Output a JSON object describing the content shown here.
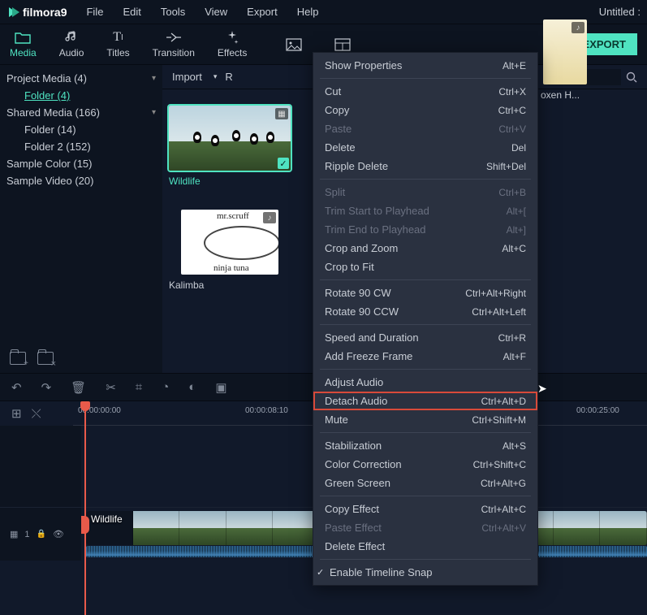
{
  "app": {
    "name": "filmora",
    "version": "9",
    "document": "Untitled :"
  },
  "menu": [
    "File",
    "Edit",
    "Tools",
    "View",
    "Export",
    "Help"
  ],
  "ribbon": {
    "tabs": [
      {
        "id": "media",
        "label": "Media"
      },
      {
        "id": "audio",
        "label": "Audio"
      },
      {
        "id": "titles",
        "label": "Titles"
      },
      {
        "id": "transition",
        "label": "Transition"
      },
      {
        "id": "effects",
        "label": "Effects"
      }
    ],
    "export_label": "EXPORT"
  },
  "sidebar": {
    "items": [
      {
        "label": "Project Media (4)",
        "expandable": true
      },
      {
        "label": "Folder (4)",
        "selected": true
      },
      {
        "label": "Shared Media (166)",
        "expandable": true
      },
      {
        "label": "Folder (14)"
      },
      {
        "label": "Folder 2 (152)"
      },
      {
        "label": "Sample Color (15)"
      },
      {
        "label": "Sample Video (20)"
      }
    ]
  },
  "media_toolbar": {
    "import": "Import",
    "record": "R",
    "search_placeholder": "Search"
  },
  "thumbs": [
    {
      "id": "wildlife",
      "label": "Wildlife",
      "selected": true,
      "type": "video"
    },
    {
      "id": "kalimba",
      "label": "Kalimba",
      "type": "audio",
      "art_text_top": "mr.scruff",
      "art_text_bottom": "ninja tuna"
    },
    {
      "id": "oxen",
      "label": "oxen H...",
      "type": "audio"
    }
  ],
  "context_menu": {
    "groups": [
      [
        {
          "label": "Show Properties",
          "shortcut": "Alt+E"
        }
      ],
      [
        {
          "label": "Cut",
          "shortcut": "Ctrl+X"
        },
        {
          "label": "Copy",
          "shortcut": "Ctrl+C"
        },
        {
          "label": "Paste",
          "shortcut": "Ctrl+V",
          "disabled": true
        },
        {
          "label": "Delete",
          "shortcut": "Del"
        },
        {
          "label": "Ripple Delete",
          "shortcut": "Shift+Del"
        }
      ],
      [
        {
          "label": "Split",
          "shortcut": "Ctrl+B",
          "disabled": true
        },
        {
          "label": "Trim Start to Playhead",
          "shortcut": "Alt+[",
          "disabled": true
        },
        {
          "label": "Trim End to Playhead",
          "shortcut": "Alt+]",
          "disabled": true
        },
        {
          "label": "Crop and Zoom",
          "shortcut": "Alt+C"
        },
        {
          "label": "Crop to Fit"
        }
      ],
      [
        {
          "label": "Rotate 90 CW",
          "shortcut": "Ctrl+Alt+Right"
        },
        {
          "label": "Rotate 90 CCW",
          "shortcut": "Ctrl+Alt+Left"
        }
      ],
      [
        {
          "label": "Speed and Duration",
          "shortcut": "Ctrl+R"
        },
        {
          "label": "Add Freeze Frame",
          "shortcut": "Alt+F"
        }
      ],
      [
        {
          "label": "Adjust Audio"
        },
        {
          "label": "Detach Audio",
          "shortcut": "Ctrl+Alt+D",
          "highlighted": true
        },
        {
          "label": "Mute",
          "shortcut": "Ctrl+Shift+M"
        }
      ],
      [
        {
          "label": "Stabilization",
          "shortcut": "Alt+S"
        },
        {
          "label": "Color Correction",
          "shortcut": "Ctrl+Shift+C"
        },
        {
          "label": "Green Screen",
          "shortcut": "Ctrl+Alt+G"
        }
      ],
      [
        {
          "label": "Copy Effect",
          "shortcut": "Ctrl+Alt+C"
        },
        {
          "label": "Paste Effect",
          "shortcut": "Ctrl+Alt+V",
          "disabled": true
        },
        {
          "label": "Delete Effect"
        }
      ],
      [
        {
          "label": "Enable Timeline Snap",
          "checked": true
        }
      ]
    ]
  },
  "timeline": {
    "times": [
      "00:00:00:00",
      "00:00:08:10",
      "00:00:25:00"
    ],
    "track_label": "1",
    "clip_label": "Wildlife"
  }
}
